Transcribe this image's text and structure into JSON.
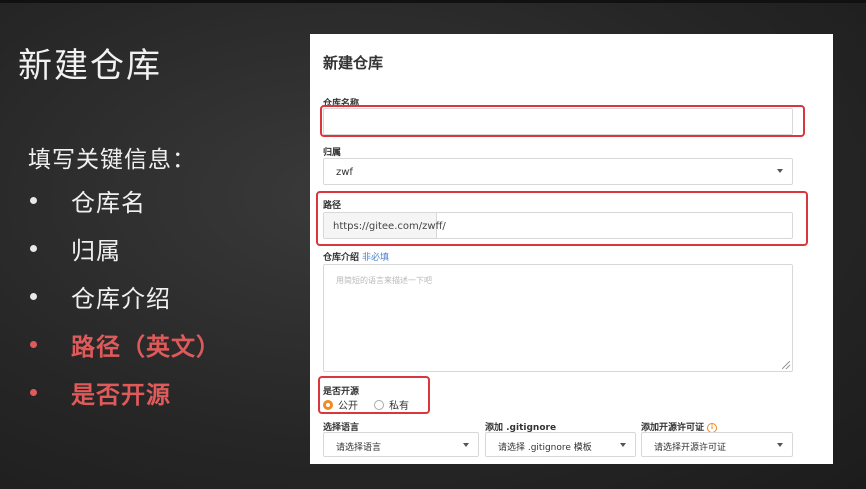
{
  "slide": {
    "title": "新建仓库",
    "intro": "填写关键信息：",
    "bullets": [
      {
        "label": "仓库名",
        "highlight": false
      },
      {
        "label": "归属",
        "highlight": false
      },
      {
        "label": "仓库介绍",
        "highlight": false
      },
      {
        "label": "路径（英文）",
        "highlight": true
      },
      {
        "label": "是否开源",
        "highlight": true
      }
    ],
    "highlight_color": "#e05a5a"
  },
  "form": {
    "title": "新建仓库",
    "repo_name": {
      "label": "仓库名称",
      "value": ""
    },
    "owner": {
      "label": "归属",
      "value": "zwf"
    },
    "path": {
      "label": "路径",
      "prefix": "https://gitee.com/zwff/",
      "value": ""
    },
    "description": {
      "label": "仓库介绍",
      "optional": "非必填",
      "placeholder": "用简短的语言来描述一下吧"
    },
    "visibility": {
      "label": "是否开源",
      "options": [
        "公开",
        "私有"
      ],
      "selected": "公开"
    },
    "language": {
      "label": "选择语言",
      "value": "请选择语言"
    },
    "gitignore": {
      "label": "添加 .gitignore",
      "value": "请选择 .gitignore 模板"
    },
    "license": {
      "label": "添加开源许可证",
      "value": "请选择开源许可证"
    },
    "accent_color": "#f08a24",
    "annotation_color": "#d9363e"
  }
}
